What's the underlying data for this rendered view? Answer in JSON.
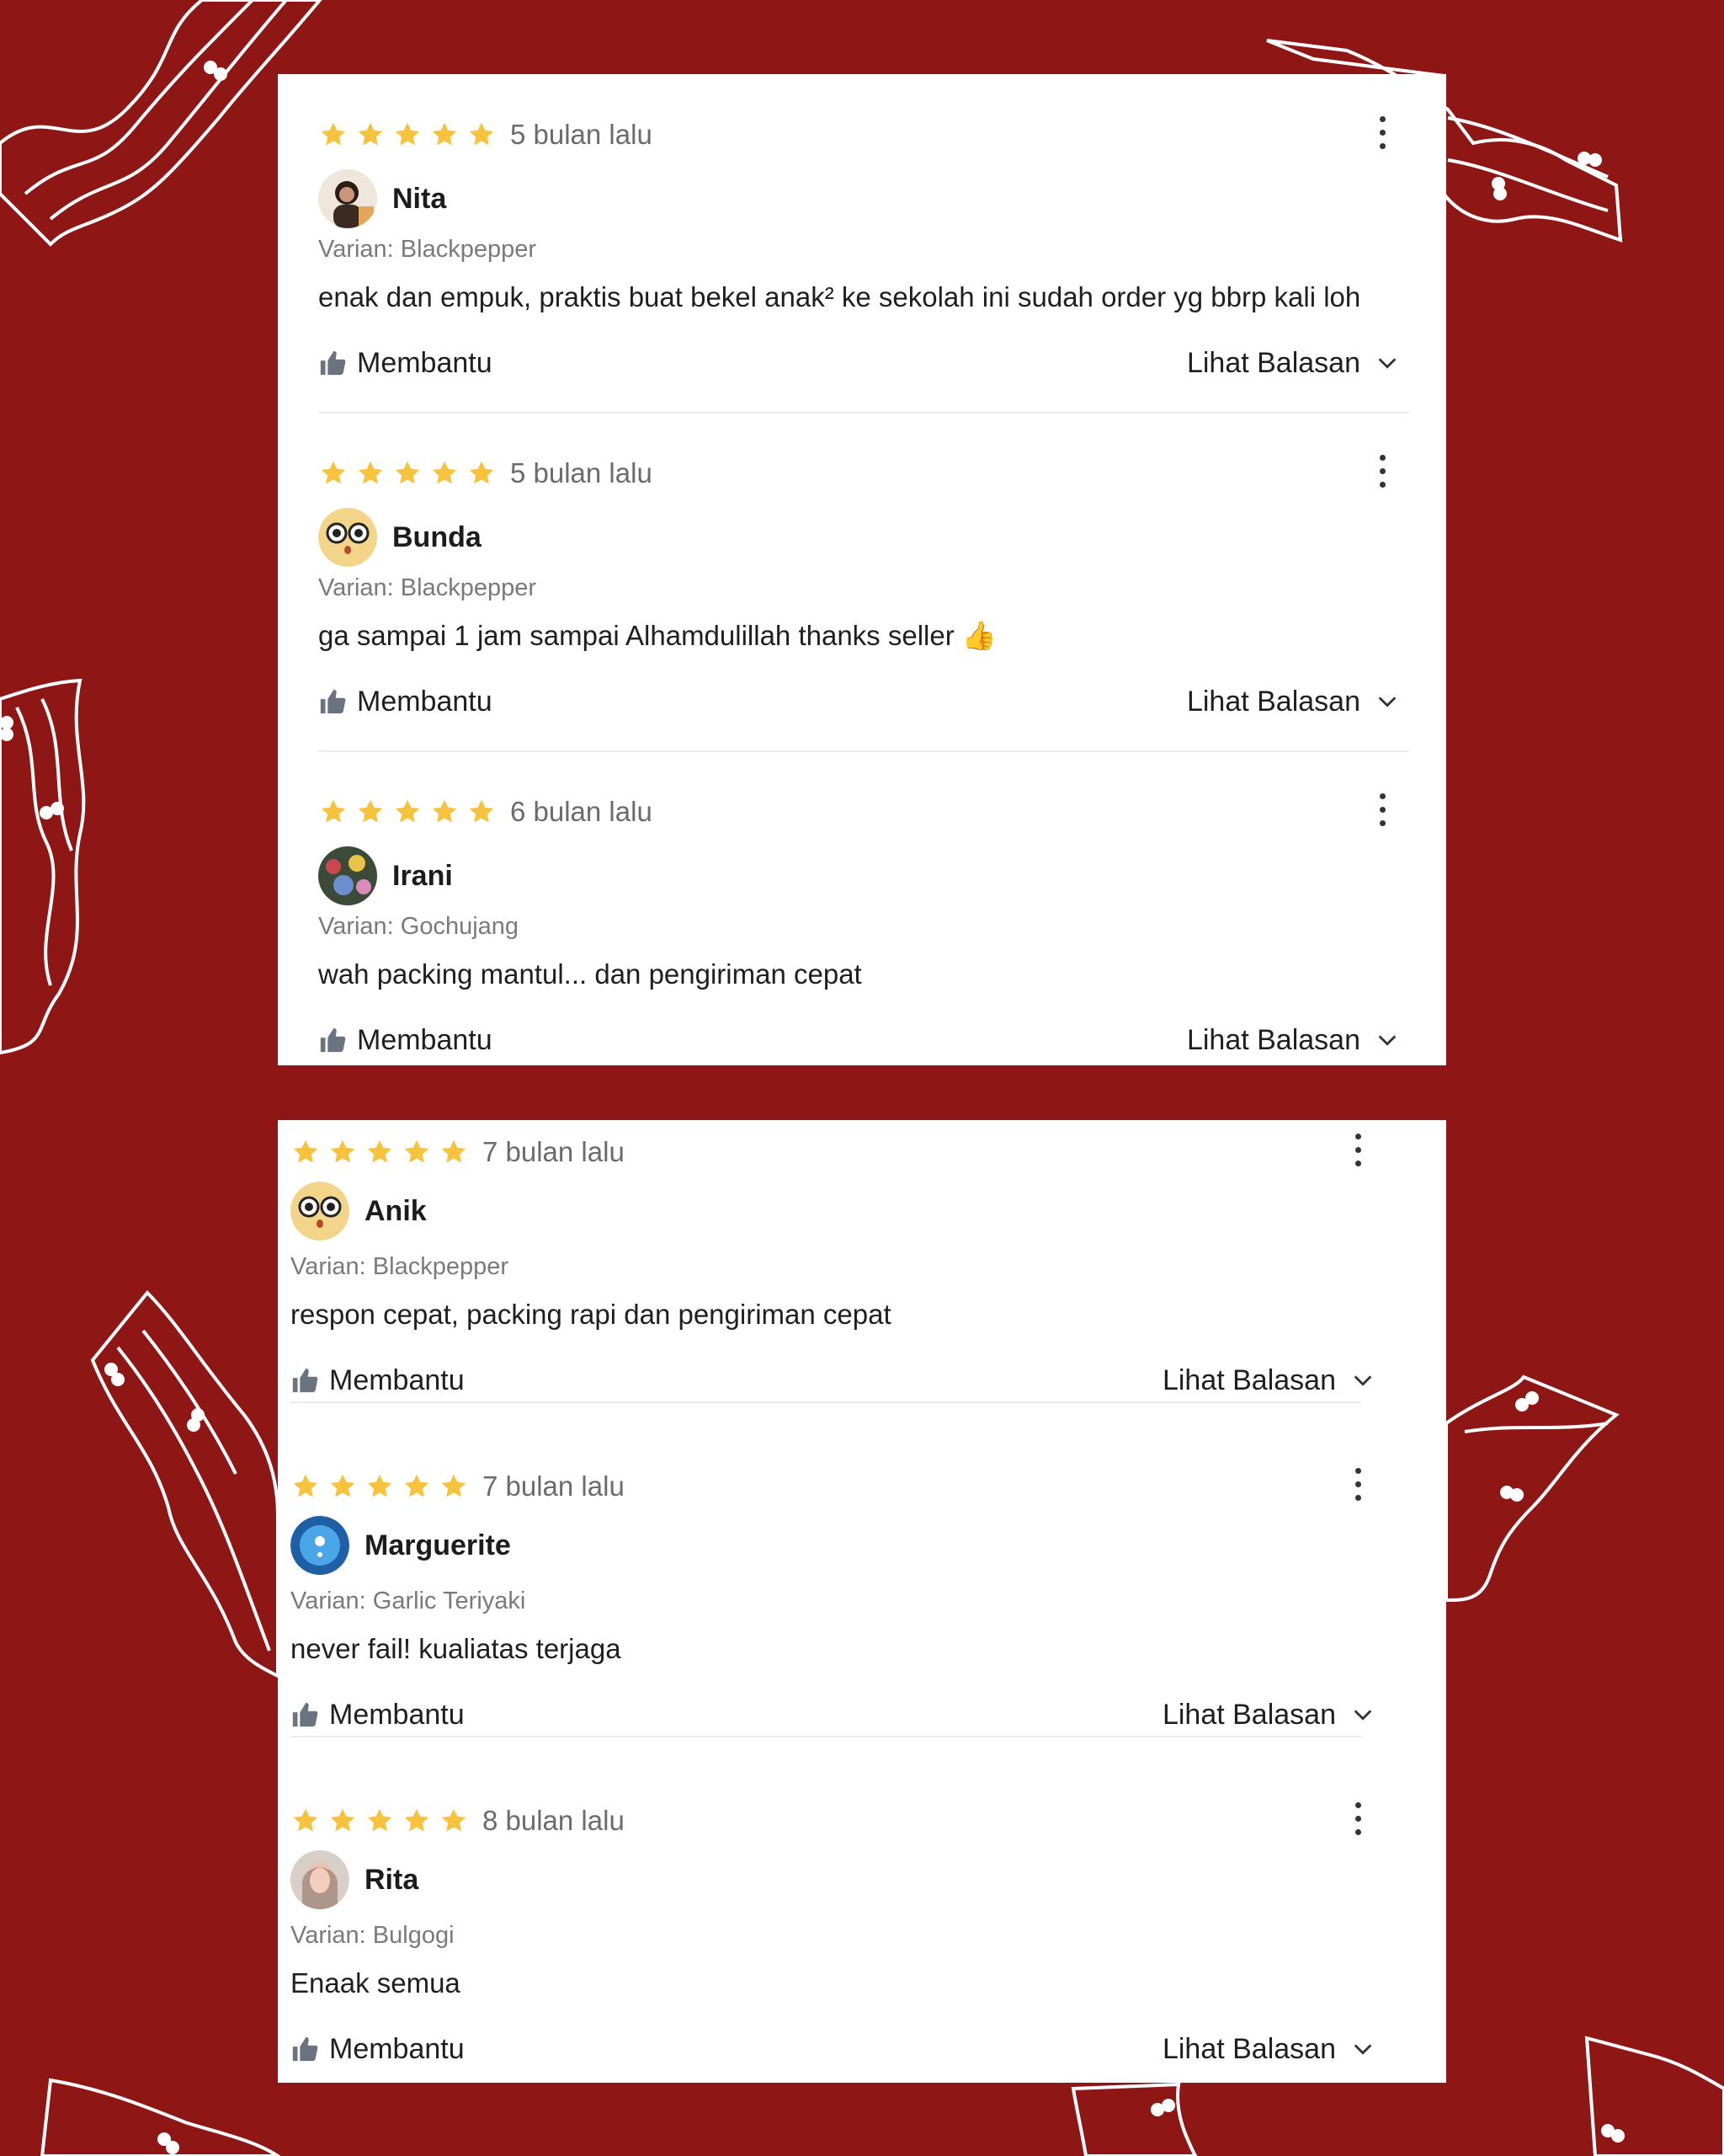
{
  "colors": {
    "background": "#8e1716",
    "star": "#f7c33d",
    "card": "#ffffff"
  },
  "cards": [
    {
      "reviews": [
        {
          "stars": 5,
          "time": "5 bulan lalu",
          "name": "Nita",
          "variant": "Varian: Blackpepper",
          "comment": "enak dan empuk, praktis buat bekel anak² ke sekolah ini sudah order yg bbrp kali loh",
          "helpful": "Membantu",
          "see_reply": "Lihat Balasan"
        },
        {
          "stars": 5,
          "time": "5 bulan lalu",
          "name": "Bunda",
          "variant": "Varian: Blackpepper",
          "comment": "ga sampai 1 jam sampai Alhamdulillah thanks seller 👍",
          "helpful": "Membantu",
          "see_reply": "Lihat Balasan"
        },
        {
          "stars": 5,
          "time": "6 bulan lalu",
          "name": "Irani",
          "variant": "Varian: Gochujang",
          "comment": "wah packing mantul... dan pengiriman cepat",
          "helpful": "Membantu",
          "see_reply": "Lihat Balasan"
        }
      ]
    },
    {
      "reviews": [
        {
          "stars": 5,
          "time": "7 bulan lalu",
          "name": "Anik",
          "variant": "Varian: Blackpepper",
          "comment": "respon cepat, packing rapi dan pengiriman cepat",
          "helpful": "Membantu",
          "see_reply": "Lihat Balasan"
        },
        {
          "stars": 5,
          "time": "7 bulan lalu",
          "name": "Marguerite",
          "variant": "Varian: Garlic Teriyaki",
          "comment": "never fail! kualiatas terjaga",
          "helpful": "Membantu",
          "see_reply": "Lihat Balasan"
        },
        {
          "stars": 5,
          "time": "8 bulan lalu",
          "name": "Rita",
          "variant": "Varian: Bulgogi",
          "comment": "Enaak semua",
          "helpful": "Membantu",
          "see_reply": "Lihat Balasan"
        }
      ]
    }
  ],
  "icons": {
    "star": "star-icon",
    "more": "more-vertical-icon",
    "thumb": "thumbs-up-icon",
    "chevron": "chevron-down-icon"
  }
}
